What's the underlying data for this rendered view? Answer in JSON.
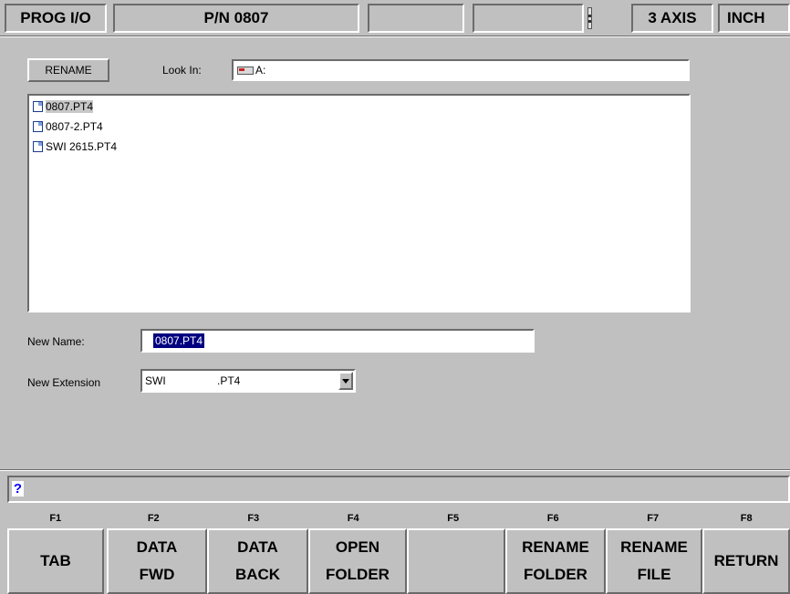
{
  "header": {
    "mode": "PROG I/O",
    "part_number": "P/N 0807",
    "axis": "3 AXIS",
    "units": "INCH"
  },
  "dialog": {
    "title_button": "RENAME",
    "look_in_label": "Look In:",
    "look_in_value": "A:",
    "files": [
      "0807.PT4",
      "0807-2.PT4",
      "SWI 2615.PT4"
    ],
    "new_name_label": "New Name:",
    "new_name_value": "0807.PT4",
    "new_ext_label": "New Extension",
    "new_ext_prefix": "SWI",
    "new_ext_value": ".PT4"
  },
  "message_bar": {
    "icon": "?"
  },
  "fkeys": [
    "F1",
    "F2",
    "F3",
    "F4",
    "F5",
    "F6",
    "F7",
    "F8"
  ],
  "softkeys": [
    {
      "line1": "TAB",
      "line2": ""
    },
    {
      "line1": "DATA",
      "line2": "FWD"
    },
    {
      "line1": "DATA",
      "line2": "BACK"
    },
    {
      "line1": "OPEN",
      "line2": "FOLDER"
    },
    {
      "line1": "",
      "line2": ""
    },
    {
      "line1": "RENAME",
      "line2": "FOLDER"
    },
    {
      "line1": "RENAME",
      "line2": "FILE"
    },
    {
      "line1": "RETURN",
      "line2": ""
    }
  ],
  "colors": {
    "panel": "#c0c0c0",
    "selection": "#000080",
    "help_icon": "#0000ff"
  }
}
